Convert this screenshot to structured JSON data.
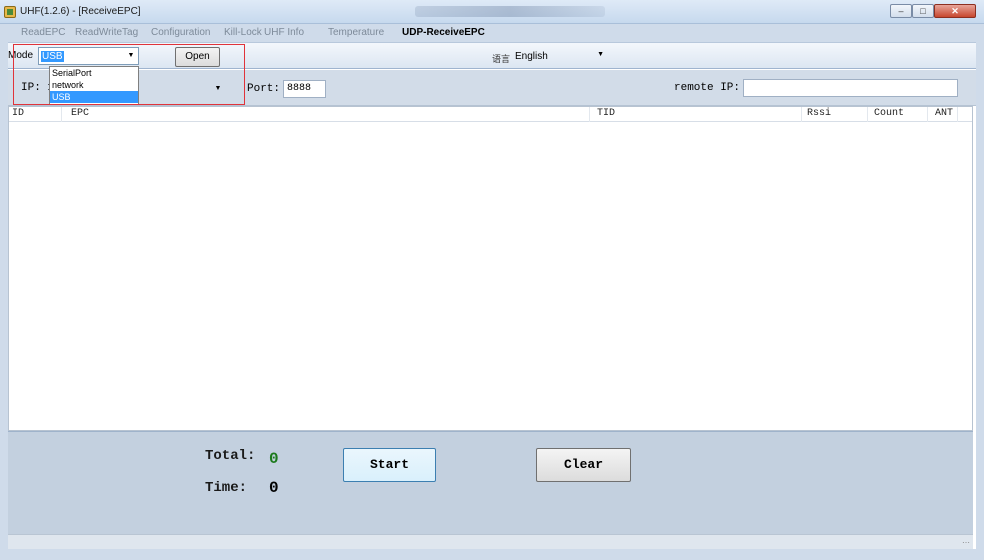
{
  "window": {
    "title": "UHF(1.2.6) - [ReceiveEPC]",
    "min": "–",
    "max": "□",
    "close": "✕"
  },
  "menu": [
    {
      "label": "ReadEPC"
    },
    {
      "label": "ReadWriteTag"
    },
    {
      "label": "Configuration"
    },
    {
      "label": "Kill-Lock"
    },
    {
      "label": "UHF Info"
    },
    {
      "label": "Temperature"
    },
    {
      "label": "UDP-ReceiveEPC"
    }
  ],
  "toolbar": {
    "mode_label": "Mode",
    "mode_value": "USB",
    "open_label": "Open",
    "lang_label": "语言",
    "lang_value": "English"
  },
  "mode_options": [
    "SerialPort",
    "network",
    "USB"
  ],
  "network": {
    "ip_label": "IP: 1",
    "port_label": "Port:",
    "port_value": "8888",
    "remote_label": "remote IP:",
    "remote_value": ""
  },
  "table": {
    "columns": [
      {
        "label": "ID"
      },
      {
        "label": "EPC"
      },
      {
        "label": "TID"
      },
      {
        "label": "Rssi"
      },
      {
        "label": "Count"
      },
      {
        "label": "ANT"
      }
    ]
  },
  "stats": {
    "total_label": "Total:",
    "total_value": "0",
    "time_label": "Time:",
    "time_value": "0"
  },
  "actions": {
    "start_label": "Start",
    "clear_label": "Clear"
  },
  "colors": {
    "total_value": "#1c7a1c",
    "highlight": "#e0333a",
    "selection": "#3399ff"
  }
}
